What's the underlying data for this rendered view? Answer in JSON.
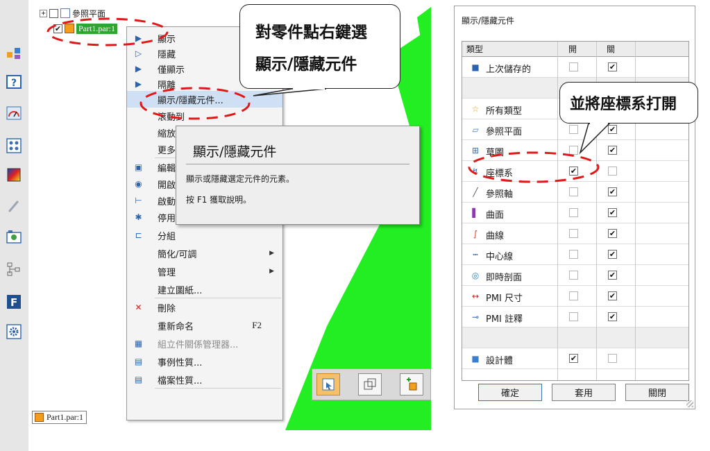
{
  "left_toolbar": {
    "icons": [
      "assembly-icon",
      "help-icon",
      "gauge-icon",
      "grid-icon",
      "color-icon",
      "brush-icon",
      "view-icon",
      "tree-icon",
      "f-icon",
      "gear-icon"
    ]
  },
  "tree": {
    "ref_planes_label": "參照平面",
    "part_label": "Part1.par:1",
    "bottom_tab": "Part1.par:1"
  },
  "context_menu": {
    "items": [
      {
        "label": "顯示",
        "icon": "show-icon"
      },
      {
        "label": "隱藏",
        "icon": "hide-icon"
      },
      {
        "label": "僅顯示",
        "icon": "show-only-icon"
      },
      {
        "label": "隔離",
        "icon": "isolate-icon"
      },
      {
        "label": "顯示/隱藏元件...",
        "icon": ""
      },
      {
        "label": "滾動到",
        "icon": ""
      },
      {
        "label": "縮放",
        "icon": ""
      },
      {
        "label": "更多",
        "icon": ""
      },
      {
        "label": "編輯",
        "icon": "edit-icon"
      },
      {
        "label": "開啟",
        "icon": "open-icon"
      },
      {
        "label": "啟動",
        "icon": "activate-icon"
      },
      {
        "label": "停用",
        "icon": "deactivate-icon"
      },
      {
        "label": "分組",
        "icon": "group-icon"
      },
      {
        "label": "簡化/可調",
        "icon": ""
      },
      {
        "label": "管理",
        "icon": ""
      },
      {
        "label": "建立圖紙...",
        "icon": ""
      },
      {
        "label": "刪除",
        "icon": "delete-icon"
      },
      {
        "label": "重新命名",
        "icon": "",
        "shortcut": "F2"
      },
      {
        "label": "組立件關係管理器...",
        "icon": "relationship-icon"
      },
      {
        "label": "事例性質...",
        "icon": "occurrence-properties-icon"
      },
      {
        "label": "檔案性質...",
        "icon": "file-properties-icon"
      }
    ]
  },
  "tooltip": {
    "title": "顯示/隱藏元件",
    "description": "顯示或隱藏選定元件的元素。",
    "help": "按 F1 獲取說明。"
  },
  "callouts": {
    "left_line1": "對零件點右鍵選",
    "left_line2": "顯示/隱藏元件",
    "right": "並將座標系打開"
  },
  "dialog": {
    "title": "顯示/隱藏元件",
    "columns": {
      "type": "類型",
      "on": "開",
      "off": "關"
    },
    "rows": [
      {
        "label": "上次儲存的",
        "icon": "save-icon",
        "on": false,
        "off": true
      },
      {
        "label": "所有類型",
        "icon": "star-icon",
        "on": null,
        "off": null
      },
      {
        "label": "參照平面",
        "icon": "plane-icon",
        "on": false,
        "off": true
      },
      {
        "label": "草圖",
        "icon": "sketch-icon",
        "on": false,
        "off": true
      },
      {
        "label": "座標系",
        "icon": "coordinate-system-icon",
        "on": true,
        "off": false
      },
      {
        "label": "參照軸",
        "icon": "axis-icon",
        "on": false,
        "off": true
      },
      {
        "label": "曲面",
        "icon": "surface-icon",
        "on": false,
        "off": true
      },
      {
        "label": "曲線",
        "icon": "curve-icon",
        "on": false,
        "off": true
      },
      {
        "label": "中心線",
        "icon": "centerline-icon",
        "on": false,
        "off": true
      },
      {
        "label": "即時剖面",
        "icon": "live-section-icon",
        "on": false,
        "off": true
      },
      {
        "label": "PMI 尺寸",
        "icon": "pmi-dimension-icon",
        "on": false,
        "off": true
      },
      {
        "label": "PMI 註釋",
        "icon": "pmi-annotation-icon",
        "on": false,
        "off": true
      },
      {
        "label": "設計體",
        "icon": "design-body-icon",
        "on": true,
        "off": false
      }
    ],
    "buttons": {
      "ok": "確定",
      "apply": "套用",
      "close": "關閉"
    }
  },
  "colors": {
    "green_body": "#22ee22",
    "selection_green": "#2ea52e",
    "highlight": "#cfe0f4",
    "annotation_red": "#e01818"
  }
}
